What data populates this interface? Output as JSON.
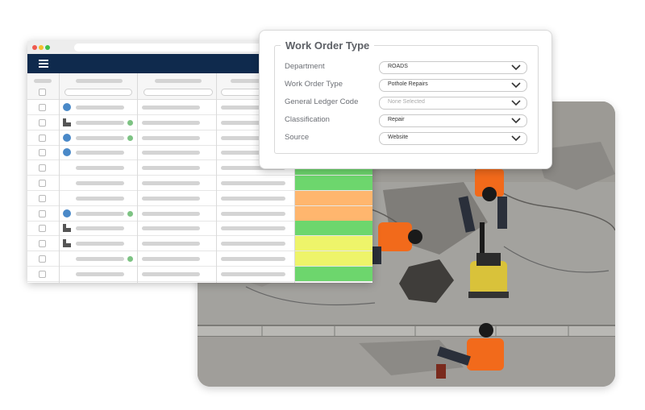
{
  "work_order": {
    "title": "Work Order Type",
    "fields": [
      {
        "label": "Department",
        "value": "ROADS",
        "placeholder": false
      },
      {
        "label": "Work Order Type",
        "value": "Pothole Repairs",
        "placeholder": false
      },
      {
        "label": "General Ledger Code",
        "value": "None Selected",
        "placeholder": true
      },
      {
        "label": "Classification",
        "value": "Repair",
        "placeholder": false
      },
      {
        "label": "Source",
        "value": "Website",
        "placeholder": false
      }
    ]
  },
  "table": {
    "rows": [
      {
        "icon": "circle",
        "dot": false,
        "status": null
      },
      {
        "icon": "building",
        "dot": true,
        "status": null
      },
      {
        "icon": "circle",
        "dot": true,
        "status": null
      },
      {
        "icon": "circle",
        "dot": false,
        "status": null
      },
      {
        "icon": null,
        "dot": false,
        "status": "#6dd66d"
      },
      {
        "icon": null,
        "dot": false,
        "status": "#6dd66d"
      },
      {
        "icon": null,
        "dot": false,
        "status": "#ffb66e"
      },
      {
        "icon": "circle",
        "dot": true,
        "status": "#ffb66e"
      },
      {
        "icon": "building",
        "dot": false,
        "status": "#6dd66d"
      },
      {
        "icon": "building",
        "dot": false,
        "status": "#eef46a"
      },
      {
        "icon": null,
        "dot": true,
        "status": "#eef46a"
      },
      {
        "icon": null,
        "dot": false,
        "status": "#6dd66d"
      }
    ]
  },
  "colors": {
    "navbar": "#0f2a4d",
    "status_green": "#6dd66d",
    "status_orange": "#ffb66e",
    "status_yellow": "#eef46a",
    "icon_blue": "#4a89c8",
    "dot_green": "#7dc383",
    "safety_vest": "#f26a1b"
  },
  "icons": {
    "menu": "hamburger-icon",
    "dropdown": "chevron-down-icon",
    "row_circle": "blue-circle-icon",
    "row_building": "building-icon"
  }
}
